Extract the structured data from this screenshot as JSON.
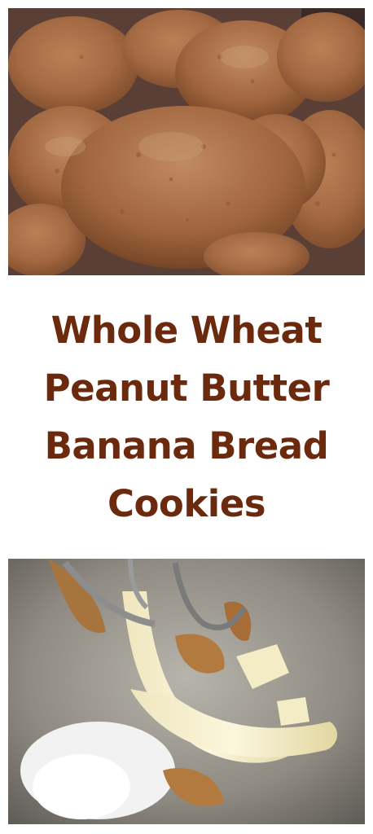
{
  "colors": {
    "title": "#6b2a0e",
    "background": "#ffffff"
  },
  "top_photo": {
    "subject": "peanut butter cookies"
  },
  "title": {
    "lines": [
      "Whole Wheat",
      "Peanut Butter",
      "Banana Bread",
      "Cookies"
    ]
  },
  "bottom_photo": {
    "subject": "bananas, peanut butter and sugar in mixing bowl"
  }
}
